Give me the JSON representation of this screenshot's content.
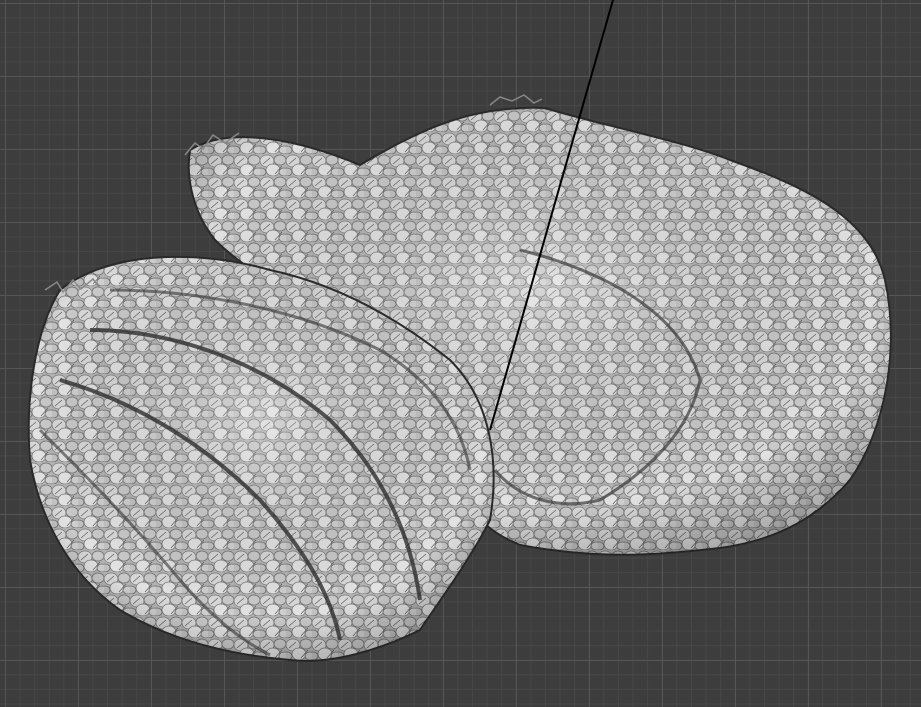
{
  "viewport": {
    "background_color": "#3d3d3d",
    "grid_major_color": "#555555",
    "grid_minor_color": "#474747",
    "mesh_color": "#bdbdbd",
    "mesh_shadow_color": "#6f6f6f",
    "line_color": "#000000"
  }
}
